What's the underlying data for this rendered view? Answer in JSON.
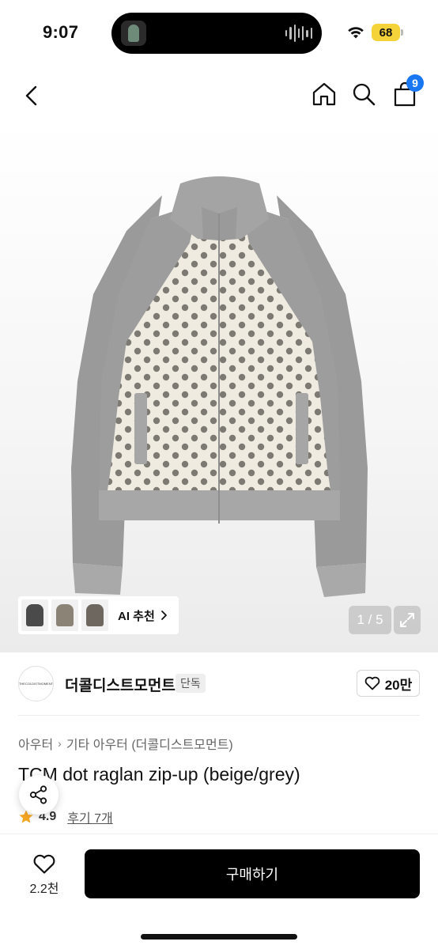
{
  "status_bar": {
    "time": "9:07",
    "battery": "68",
    "icons": [
      "wifi-icon",
      "battery-icon"
    ]
  },
  "nav": {
    "back_icon": "chevron-left-icon",
    "home_icon": "home-icon",
    "search_icon": "search-icon",
    "cart_icon": "shopping-bag-icon",
    "cart_count": "9"
  },
  "gallery": {
    "ai_recommend_label": "AI 추천",
    "page_indicator": "1 / 5",
    "expand_icon": "expand-icon"
  },
  "brand": {
    "logo_text": "THECOLDISTMOMENT",
    "name": "더콜디스트모먼트",
    "tag": "단독",
    "like_count": "20만"
  },
  "breadcrumb": [
    "아우터",
    "기타 아우터 (더콜디스트모먼트)"
  ],
  "product": {
    "title": "TCM dot raglan zip-up (beige/grey)",
    "rating": "4.9",
    "reviews_label": "후기 7개"
  },
  "bottom_bar": {
    "wish_count": "2.2천",
    "buy_label": "구매하기"
  },
  "colors": {
    "accent": "#1977f2",
    "star": "#f5a623",
    "buy_button": "#000000",
    "battery": "#f4d23a"
  }
}
